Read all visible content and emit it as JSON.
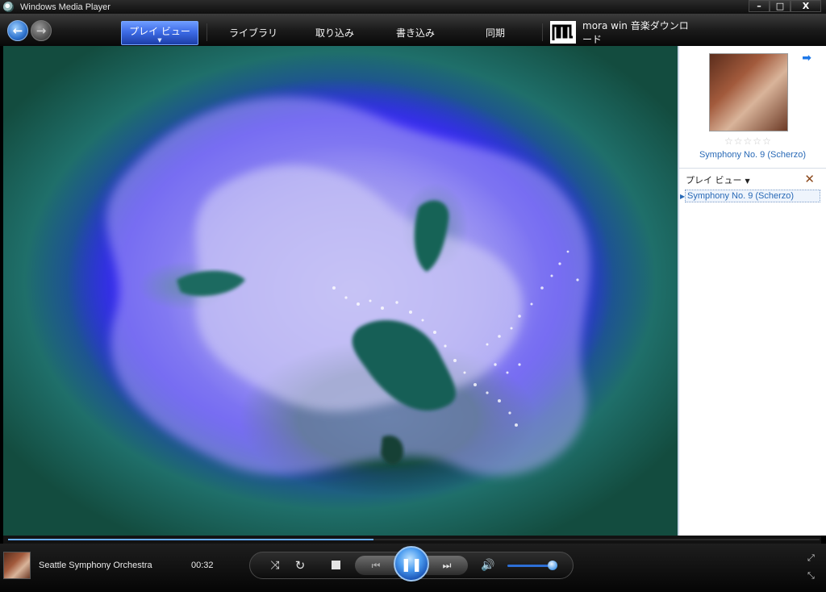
{
  "window": {
    "title": "Windows Media Player",
    "controls": {
      "minimize": "–",
      "maximize": "□",
      "close": "X"
    }
  },
  "nav": {
    "back_icon": "←",
    "forward_icon": "→",
    "tabs": [
      {
        "label": "プレイ ビュー",
        "active": true
      },
      {
        "label": "ライブラリ"
      },
      {
        "label": "取り込み"
      },
      {
        "label": "書き込み"
      },
      {
        "label": "同期"
      },
      {
        "label": "mora win 音楽ダウンロード"
      }
    ]
  },
  "visualization": {
    "colors": {
      "deep": "#134c3f",
      "blue": "#2a1ff1",
      "violet": "#6c62f0",
      "lavender": "#c7c4f5"
    }
  },
  "side_pane": {
    "album_title": "Symphony No. 9 (Scherzo)",
    "rating": 0,
    "rating_max": 5,
    "playlist_header": "プレイ ビュー",
    "playlist": [
      "Symphony No. 9 (Scherzo)"
    ]
  },
  "player": {
    "artist": "Seattle Symphony Orchestra",
    "elapsed": "00:32",
    "seek_fraction": 0.45,
    "volume_fraction": 0.9,
    "icons": {
      "shuffle": "⤨",
      "repeat": "↻",
      "prev": "⏮",
      "play_pause": "❚❚",
      "next": "⏭",
      "mute": "🔊"
    }
  },
  "colors": {
    "accent": "#3d6be6",
    "link": "#2869b6"
  }
}
